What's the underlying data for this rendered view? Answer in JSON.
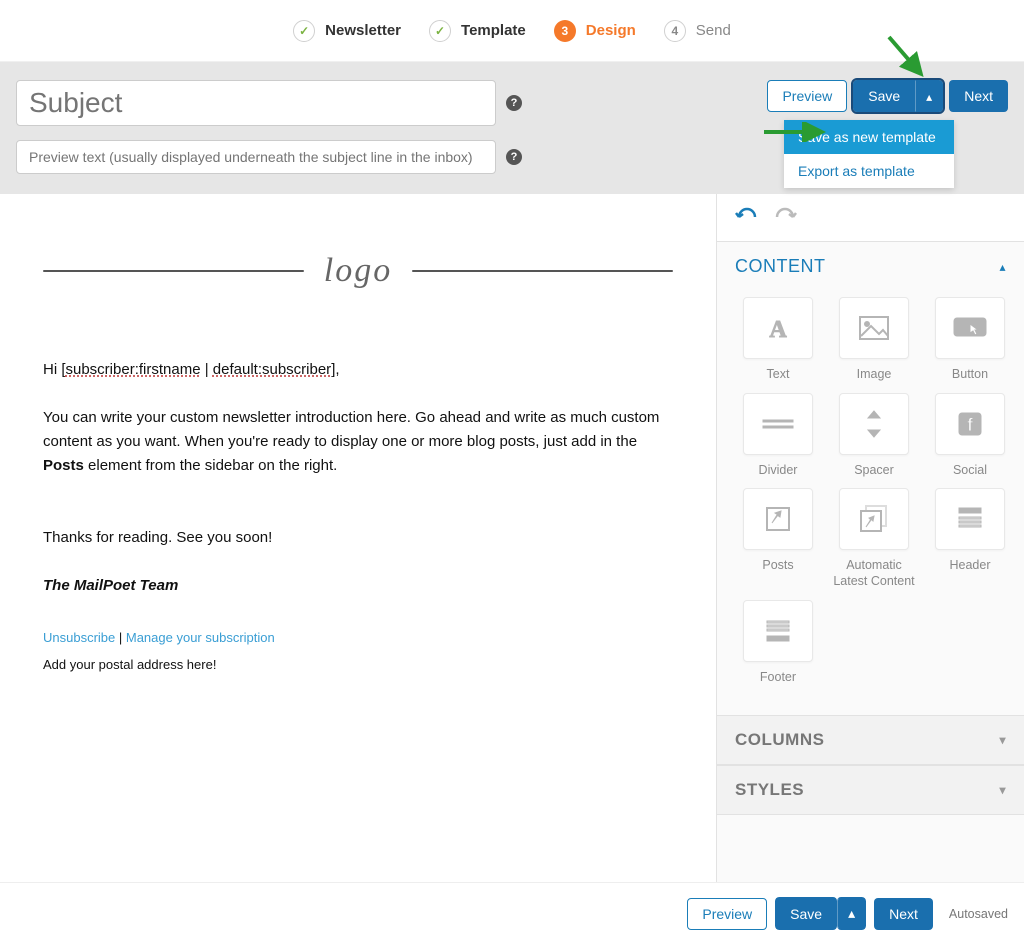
{
  "steps": [
    {
      "label": "Newsletter",
      "state": "done",
      "mark": "✓"
    },
    {
      "label": "Template",
      "state": "done",
      "mark": "✓"
    },
    {
      "label": "Design",
      "state": "active",
      "mark": "3"
    },
    {
      "label": "Send",
      "state": "upcoming",
      "mark": "4"
    }
  ],
  "header": {
    "subject_placeholder": "Subject",
    "preview_placeholder": "Preview text (usually displayed underneath the subject line in the inbox)",
    "preview_btn": "Preview",
    "save_btn": "Save",
    "next_btn": "Next",
    "dropdown": {
      "save_template": "Save as new template",
      "export_template": "Export as template"
    }
  },
  "canvas": {
    "logo_text": "logo",
    "greeting_prefix": "Hi [",
    "token1": "subscriber:firstname",
    "token_sep": " | ",
    "token2": "default:subscriber",
    "greeting_suffix": "],",
    "body_1_a": "You can write your custom newsletter introduction here. Go ahead and write as much custom content as you want. When you're ready to display one or more blog posts, just add in the ",
    "body_1_bold": "Posts",
    "body_1_b": " element from the sidebar on the right.",
    "body_2": "Thanks for reading. See you soon!",
    "signature": "The MailPoet Team",
    "unsubscribe": "Unsubscribe",
    "pipe": " | ",
    "manage": "Manage your subscription",
    "postal": "Add your postal address here!"
  },
  "sidebar": {
    "content_title": "CONTENT",
    "columns_title": "COLUMNS",
    "styles_title": "STYLES",
    "tiles": {
      "text": "Text",
      "image": "Image",
      "button": "Button",
      "divider": "Divider",
      "spacer": "Spacer",
      "social": "Social",
      "posts": "Posts",
      "alc": "Automatic Latest Content",
      "header": "Header",
      "footer": "Footer"
    }
  },
  "bottom": {
    "preview": "Preview",
    "save": "Save",
    "next": "Next",
    "autosaved": "Autosaved"
  }
}
